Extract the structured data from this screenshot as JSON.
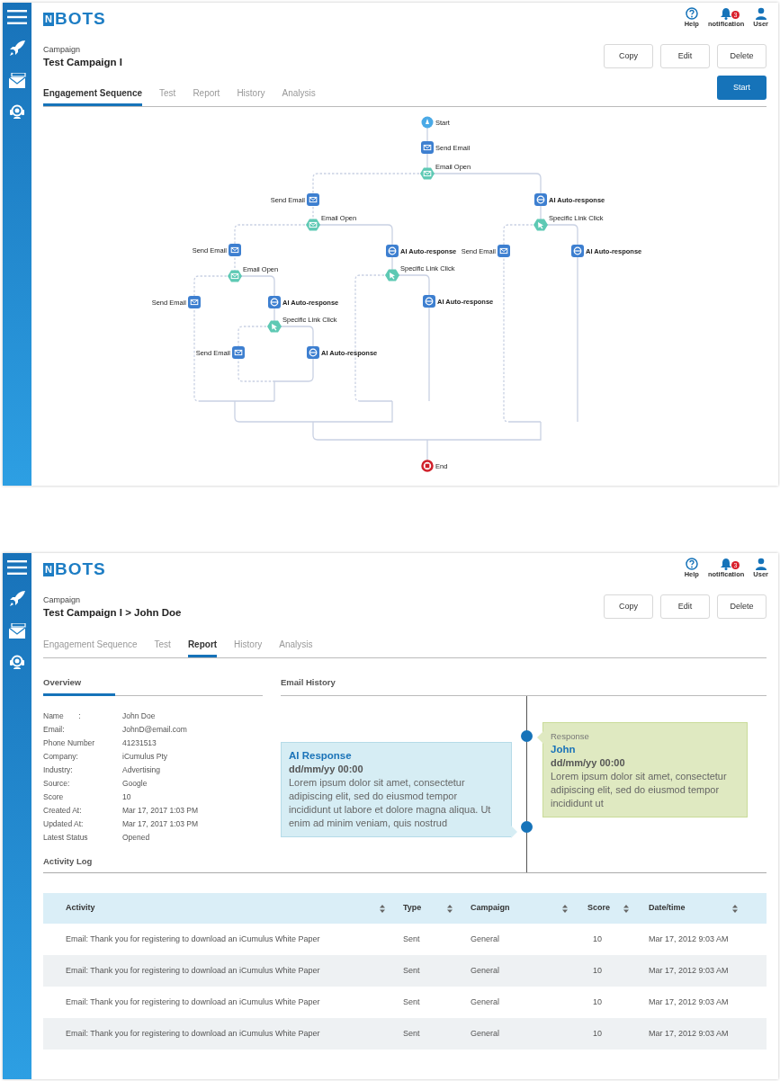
{
  "screens": [
    {
      "kind": "sequence",
      "logo": {
        "badge": "N",
        "text": "BOTS"
      },
      "header_icons": [
        {
          "kind": "help",
          "label": "Help"
        },
        {
          "kind": "notification",
          "label": "notification",
          "badge": "3"
        },
        {
          "kind": "user",
          "label": "User"
        }
      ],
      "breadcrumb": "Campaign",
      "title": "Test Campaign I",
      "actions": [
        "Copy",
        "Edit",
        "Delete"
      ],
      "primary_action": "Start",
      "tabs": [
        {
          "label": "Engagement Sequence",
          "selected": true
        },
        {
          "label": "Test",
          "selected": false
        },
        {
          "label": "Report",
          "selected": false
        },
        {
          "label": "History",
          "selected": false
        },
        {
          "label": "Analysis",
          "selected": false
        }
      ],
      "flow": {
        "nodes": [
          {
            "kind": "start",
            "label": "Start"
          },
          {
            "kind": "email",
            "label": "Send Email"
          },
          {
            "kind": "open",
            "label": "Email Open"
          },
          {
            "kind": "email",
            "label": "Send Email"
          },
          {
            "kind": "ai",
            "label": "AI Auto-response"
          },
          {
            "kind": "open",
            "label": "Email Open"
          },
          {
            "kind": "click",
            "label": "Specific Link Click"
          },
          {
            "kind": "email",
            "label": "Send Email"
          },
          {
            "kind": "ai",
            "label": "AI Auto-response"
          },
          {
            "kind": "email",
            "label": "Send Email"
          },
          {
            "kind": "ai",
            "label": "AI Auto-response"
          },
          {
            "kind": "open",
            "label": "Email Open"
          },
          {
            "kind": "click",
            "label": "Specific Link Click"
          },
          {
            "kind": "email",
            "label": "Send Email"
          },
          {
            "kind": "ai",
            "label": "AI Auto-response"
          },
          {
            "kind": "ai",
            "label": "AI Auto-response"
          },
          {
            "kind": "click",
            "label": "Specific Link Click"
          },
          {
            "kind": "email",
            "label": "Send Email"
          },
          {
            "kind": "ai",
            "label": "AI Auto-response"
          },
          {
            "kind": "end",
            "label": "End"
          }
        ]
      }
    },
    {
      "kind": "report",
      "logo": {
        "badge": "N",
        "text": "BOTS"
      },
      "header_icons": [
        {
          "kind": "help",
          "label": "Help"
        },
        {
          "kind": "notification",
          "label": "notification",
          "badge": "3"
        },
        {
          "kind": "user",
          "label": "User"
        }
      ],
      "breadcrumb": "Campaign",
      "title": "Test Campaign I > John Doe",
      "actions": [
        "Copy",
        "Edit",
        "Delete"
      ],
      "tabs": [
        {
          "label": "Engagement Sequence",
          "selected": false
        },
        {
          "label": "Test",
          "selected": false
        },
        {
          "label": "Report",
          "selected": true
        },
        {
          "label": "History",
          "selected": false
        },
        {
          "label": "Analysis",
          "selected": false
        }
      ],
      "overview": {
        "heading": "Overview",
        "fields": [
          {
            "label": "Name       :",
            "value": "John Doe"
          },
          {
            "label": "Email:",
            "value": "JohnD@email.com"
          },
          {
            "label": "Phone Number",
            "value": "41231513"
          },
          {
            "label": "Company:",
            "value": "iCumulus Pty"
          },
          {
            "label": "Industry:",
            "value": "Advertising"
          },
          {
            "label": "Source:",
            "value": "Google"
          },
          {
            "label": "Score",
            "value": "10"
          },
          {
            "label": "Created At:",
            "value": "Mar 17, 2017 1:03 PM"
          },
          {
            "label": "Updated At:",
            "value": "Mar 17, 2017 1:03 PM"
          },
          {
            "label": "Latest Status",
            "value": "Opened"
          }
        ]
      },
      "email_history": {
        "heading": "Email History",
        "items": [
          {
            "kind": "response",
            "label": "Response",
            "sender": "John",
            "date": "dd/mm/yy 00:00",
            "body": "Lorem ipsum dolor sit amet, consectetur adipiscing elit, sed do eiusmod tempor incididunt ut"
          },
          {
            "kind": "ai",
            "sender": "AI Response",
            "date": "dd/mm/yy 00:00",
            "body": "Lorem ipsum dolor sit amet, consectetur adipiscing elit, sed do eiusmod tempor incididunt ut labore et dolore magna aliqua. Ut enim ad minim veniam, quis nostrud"
          }
        ]
      },
      "activity_log": {
        "heading": "Activity Log",
        "columns": [
          "Activity",
          "Type",
          "Campaign",
          "Score",
          "Date/time"
        ],
        "rows": [
          [
            "Email: Thank you for registering to download an iCumulus White Paper",
            "Sent",
            "General",
            "10",
            "Mar 17, 2012 9:03 AM"
          ],
          [
            "Email: Thank you for registering to download an iCumulus White Paper",
            "Sent",
            "General",
            "10",
            "Mar 17, 2012 9:03 AM"
          ],
          [
            "Email: Thank you for registering to download an iCumulus White Paper",
            "Sent",
            "General",
            "10",
            "Mar 17, 2012 9:03 AM"
          ],
          [
            "Email: Thank you for registering to download an iCumulus White Paper",
            "Sent",
            "General",
            "10",
            "Mar 17, 2012 9:03 AM"
          ]
        ]
      }
    }
  ]
}
